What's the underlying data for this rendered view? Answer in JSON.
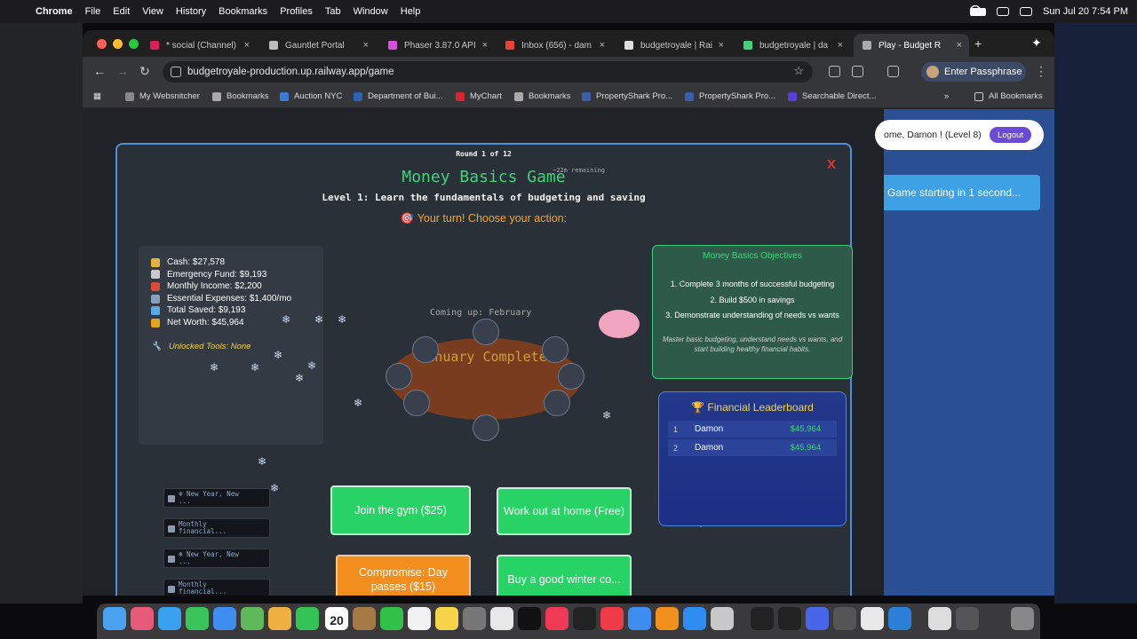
{
  "menubar": {
    "app": "Chrome",
    "items": [
      "File",
      "Edit",
      "View",
      "History",
      "Bookmarks",
      "Profiles",
      "Tab",
      "Window",
      "Help"
    ],
    "clock": "Sun Jul 20  7:54 PM"
  },
  "tabs": [
    {
      "label": "* social (Channel)",
      "color": "#e01e5a"
    },
    {
      "label": "Gauntlet Portal",
      "color": "#bbbbbb"
    },
    {
      "label": "Phaser 3.87.0 API",
      "color": "#d94fd9"
    },
    {
      "label": "Inbox (656) - dam",
      "color": "#ea4335"
    },
    {
      "label": "budgetroyale | Rai",
      "color": "#dddddd"
    },
    {
      "label": "budgetroyale | da",
      "color": "#3fd47a"
    },
    {
      "label": "Play - Budget R",
      "color": "#aaaaaa"
    }
  ],
  "toolbar": {
    "url": "budgetroyale-production.up.railway.app/game",
    "profile_label": "Enter Passphrase"
  },
  "bookmarks": {
    "items": [
      {
        "label": "My Websnitcher",
        "color": "#888888"
      },
      {
        "label": "Bookmarks",
        "color": "#aaaaaa"
      },
      {
        "label": "Auction NYC",
        "color": "#3a7bd5"
      },
      {
        "label": "Department of Bui...",
        "color": "#2a62b8"
      },
      {
        "label": "MyChart",
        "color": "#d7262e"
      },
      {
        "label": "Bookmarks",
        "color": "#aaaaaa"
      },
      {
        "label": "PropertyShark Pro...",
        "color": "#3b5ea8"
      },
      {
        "label": "PropertyShark Pro...",
        "color": "#3b5ea8"
      },
      {
        "label": "Searchable Direct...",
        "color": "#5a3fd6"
      }
    ],
    "more": "»",
    "all_label": "All Bookmarks"
  },
  "side": {
    "welcome": "ome, Damon ! (Level 8)",
    "logout": "Logout",
    "banner": "Game starting in 1 second..."
  },
  "game": {
    "round": "Round 1 of 12",
    "close": "X",
    "title": "Money Basics Game",
    "time_left": "~22m remaining",
    "subtitle": "Level 1: Learn the fundamentals of budgeting and saving",
    "turn": "🎯 Your turn! Choose your action:",
    "coming_up": "Coming up: February",
    "completed": "January Completed",
    "stats": [
      {
        "text": "Cash: $27,578",
        "color": "#e6b43a"
      },
      {
        "text": "Emergency Fund: $9,193",
        "color": "#c9c9c9"
      },
      {
        "text": "Monthly Income: $2,200",
        "color": "#d94a3a"
      },
      {
        "text": "Essential Expenses: $1,400/mo",
        "color": "#8aa0b8"
      },
      {
        "text": "Total Saved: $9,193",
        "color": "#5aa8e6"
      },
      {
        "text": "Net Worth: $45,964",
        "color": "#e6a21a"
      }
    ],
    "tools": "Unlocked Tools: None",
    "objectives": {
      "title": "Money Basics Objectives",
      "items": [
        "1. Complete 3 months of successful budgeting",
        "2. Build $500 in savings",
        "3. Demonstrate understanding of needs vs wants"
      ],
      "note": "Master basic budgeting, understand needs vs wants, and start building healthy financial habits."
    },
    "leaderboard": {
      "title": "🏆 Financial Leaderboard",
      "rows": [
        {
          "rank": "1",
          "name": "Damon",
          "value": "$45,964"
        },
        {
          "rank": "2",
          "name": "Damon",
          "value": "$45,964"
        }
      ]
    },
    "cards": [
      {
        "line1": "❄ New Year, New",
        "line2": "..."
      },
      {
        "line1": "Monthly",
        "line2": "financial..."
      },
      {
        "line1": "❄ New Year, New",
        "line2": "..."
      },
      {
        "line1": "Monthly",
        "line2": "financial..."
      }
    ],
    "actions": {
      "gym": "Join the gym ($25)",
      "home": "Work out at home (Free)",
      "compromise": "Compromise: Day passes ($15)",
      "coat": "Buy a good winter co..."
    }
  }
}
